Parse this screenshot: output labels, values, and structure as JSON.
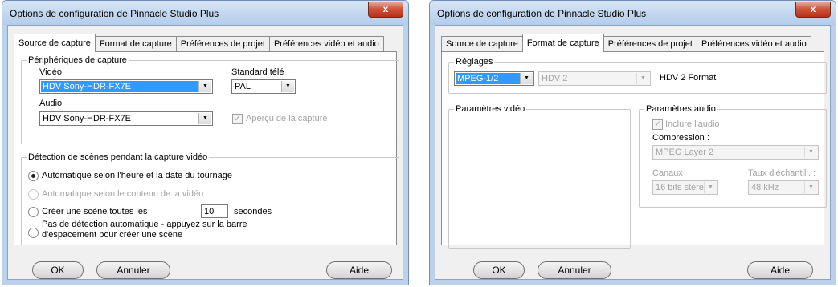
{
  "left": {
    "title": "Options de configuration de Pinnacle Studio Plus",
    "close": "x",
    "tabs": [
      "Source de capture",
      "Format de capture",
      "Préférences de projet",
      "Préférences vidéo et audio"
    ],
    "devices": {
      "group": "Périphériques de capture",
      "video_label": "Vidéo",
      "video_value": "HDV Sony-HDR-FX7E",
      "tv_label": "Standard télé",
      "tv_value": "PAL",
      "audio_label": "Audio",
      "audio_value": "HDV Sony-HDR-FX7E",
      "preview": "Aperçu de la capture"
    },
    "scenes": {
      "group": "Détection de scènes pendant la capture vidéo",
      "opt_time": "Automatique selon l'heure et la date du tournage",
      "opt_content": "Automatique selon le contenu de la vidéo",
      "opt_every": "Créer une scène toutes les",
      "every_value": "10",
      "seconds": "secondes",
      "opt_manual_1": "Pas de détection automatique - appuyez sur la barre",
      "opt_manual_2": "d'espacement pour créer une scène"
    },
    "buttons": {
      "ok": "OK",
      "cancel": "Annuler",
      "help": "Aide"
    }
  },
  "right": {
    "title": "Options de configuration de Pinnacle Studio Plus",
    "close": "x",
    "tabs": [
      "Source de capture",
      "Format de capture",
      "Préférences de projet",
      "Préférences vidéo et audio"
    ],
    "settings": {
      "group": "Réglages",
      "format_value": "MPEG-1/2",
      "preset_value": "HDV 2",
      "preset_desc": "HDV 2 Format"
    },
    "video_params": {
      "group": "Paramètres vidéo"
    },
    "audio_params": {
      "group": "Paramètres audio",
      "include_audio": "Inclure l'audio",
      "compression_label": "Compression :",
      "compression_value": "MPEG Layer 2",
      "channels_label": "Canaux",
      "channels_value": "16 bits stéréo",
      "rate_label": "Taux d'échantill. :",
      "rate_value": "48 kHz"
    },
    "buttons": {
      "ok": "OK",
      "cancel": "Annuler",
      "help": "Aide"
    }
  }
}
